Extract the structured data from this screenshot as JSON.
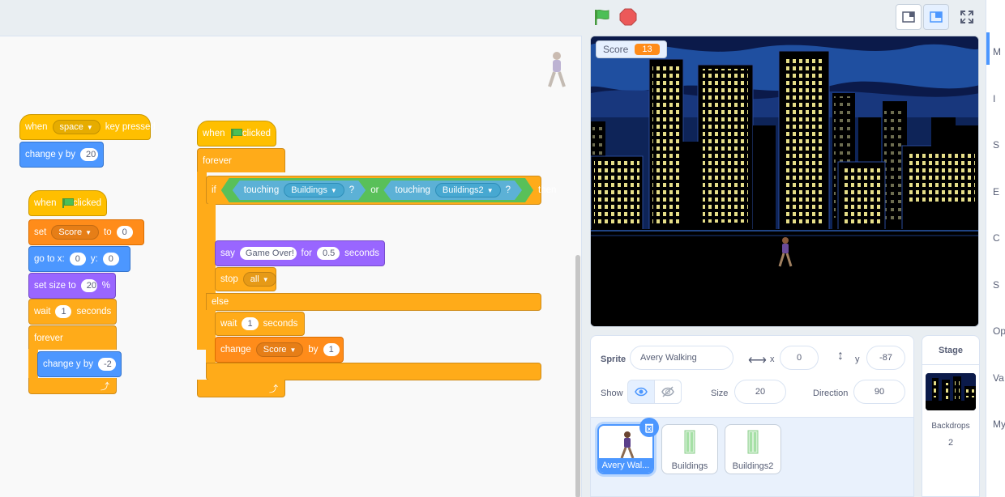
{
  "colors": {
    "motion": "#4c97ff",
    "looks": "#9966ff",
    "events": "#ffbf00",
    "control": "#ffab19",
    "variables": "#ff8c1a",
    "sensing": "#5cb1d6",
    "operators": "#59c059"
  },
  "scripts": {
    "s1": {
      "when": "when",
      "key": "space",
      "key_pressed": "key pressed",
      "change_y": "change y by",
      "change_y_val": "20"
    },
    "s2": {
      "when": "when",
      "clicked": "clicked",
      "set": "set",
      "var": "Score",
      "to": "to",
      "set_val": "0",
      "goto": "go to x:",
      "x": "0",
      "y_lbl": "y:",
      "y": "0",
      "setsize": "set size to",
      "size": "20",
      "pct": "%",
      "wait": "wait",
      "wait_val": "1",
      "seconds": "seconds",
      "forever": "forever",
      "change_y": "change y by",
      "change_y_val": "-2"
    },
    "s3": {
      "when": "when",
      "clicked": "clicked",
      "forever": "forever",
      "if": "if",
      "touching": "touching",
      "obj1": "Buildings",
      "q": "?",
      "or": "or",
      "obj2": "Buildings2",
      "then": "then",
      "say": "say",
      "say_text": "Game Over!",
      "for": "for",
      "say_secs": "0.5",
      "seconds": "seconds",
      "stop": "stop",
      "stop_opt": "all",
      "else": "else",
      "wait": "wait",
      "wait_val": "1",
      "change": "change",
      "var": "Score",
      "by": "by",
      "change_val": "1"
    }
  },
  "stage": {
    "monitor_label": "Score",
    "monitor_value": "13"
  },
  "sprite_info": {
    "sprite_label": "Sprite",
    "sprite_name": "Avery Walking",
    "x_label": "x",
    "x": "0",
    "y_label": "y",
    "y": "-87",
    "show_label": "Show",
    "size_label": "Size",
    "size": "20",
    "direction_label": "Direction",
    "direction": "90"
  },
  "sprites": [
    {
      "name": "Avery Wal...",
      "selected": true
    },
    {
      "name": "Buildings",
      "selected": false
    },
    {
      "name": "Buildings2",
      "selected": false
    }
  ],
  "stage_pane": {
    "title": "Stage",
    "backdrops_label": "Backdrops",
    "backdrops_count": "2"
  },
  "right_edge": [
    "M",
    "I",
    "S",
    "E",
    "C",
    "S",
    "Op",
    "Va",
    "My"
  ]
}
